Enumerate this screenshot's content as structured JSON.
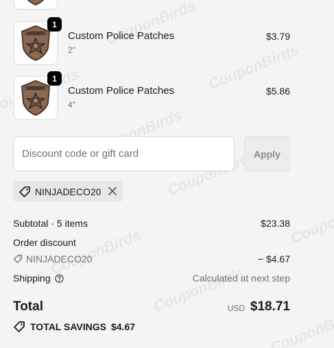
{
  "cart": {
    "items": [
      {
        "name": "Custom Police Patches",
        "variant": "2\"",
        "price": "$3.79",
        "quantity": "1",
        "image_icon": "sheriff-patch-icon"
      },
      {
        "name": "Custom Police Patches",
        "variant": "4\"",
        "price": "$5.86",
        "quantity": "1",
        "image_icon": "sheriff-patch-icon"
      }
    ]
  },
  "discount": {
    "placeholder": "Discount code or gift card",
    "apply_label": "Apply",
    "applied_code": "NINJADECO20"
  },
  "summary": {
    "subtotal_label": "Subtotal · 5 items",
    "subtotal_value": "$23.38",
    "order_discount_label": "Order discount",
    "discount_code": "NINJADECO20",
    "discount_value": "− $4.67",
    "shipping_label": "Shipping",
    "shipping_value": "Calculated at next step",
    "total_label": "Total",
    "currency": "USD",
    "total_value": "$18.71",
    "savings_label": "TOTAL SAVINGS",
    "savings_value": "$4.67"
  },
  "watermark": {
    "text": "CouponBirds"
  },
  "colors": {
    "background": "#f4f4f4",
    "badge": "#000000",
    "patch_leather": "#8a6a54"
  }
}
